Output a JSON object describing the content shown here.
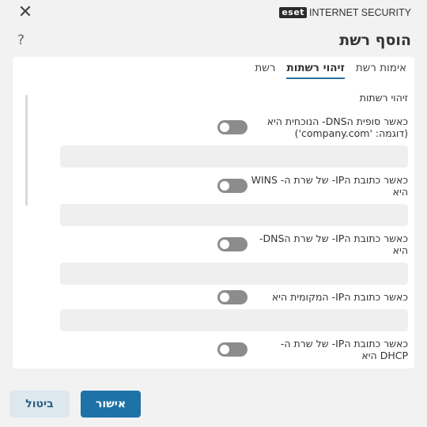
{
  "window": {
    "close_icon": "✕"
  },
  "brand": {
    "logo": "eset",
    "product": "INTERNET SECURITY"
  },
  "header": {
    "title": "הוסף רשת",
    "help": "?"
  },
  "tabs": [
    {
      "label": "רשת",
      "active": false
    },
    {
      "label": "זיהוי רשתות",
      "active": true
    },
    {
      "label": "אימות רשת",
      "active": false
    }
  ],
  "section": {
    "title": "זיהוי רשתות"
  },
  "settings": [
    {
      "label": "כאשר סופית הDNS- הנוכחית היא (דוגמה: 'company.com')",
      "enabled": false,
      "value": ""
    },
    {
      "label": "כאשר כתובת הIP- של שרת ה- WINS היא",
      "enabled": false,
      "value": ""
    },
    {
      "label": "כאשר כתובת הIP- של שרת הDNS- היא",
      "enabled": false,
      "value": ""
    },
    {
      "label": "כאשר כתובת הIP- המקומית היא",
      "enabled": false,
      "value": ""
    },
    {
      "label": "כאשר כתובת הIP- של שרת ה- DHCP היא",
      "enabled": false,
      "value": ""
    }
  ],
  "footer": {
    "ok_label": "אישור",
    "cancel_label": "ביטול"
  }
}
